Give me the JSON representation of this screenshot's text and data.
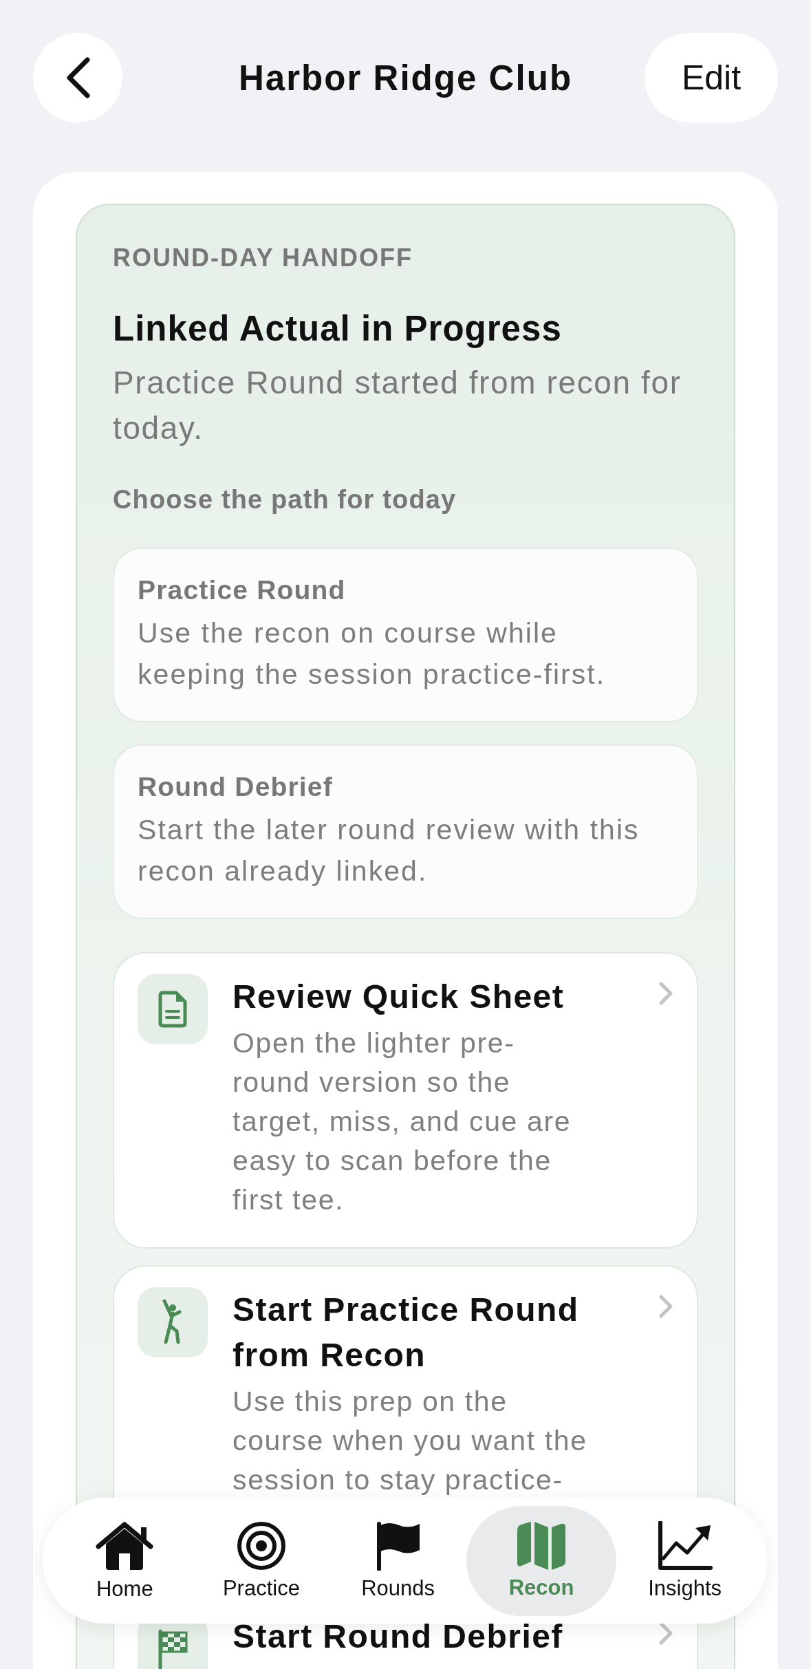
{
  "header": {
    "title": "Harbor Ridge Club",
    "edit": "Edit"
  },
  "handoff": {
    "eyebrow": "ROUND-DAY HANDOFF",
    "title": "Linked Actual in Progress",
    "subtitle": "Practice Round started from recon for today.",
    "prompt": "Choose the path for today",
    "options": [
      {
        "title": "Practice Round",
        "description": "Use the recon on course while keeping the session practice-first."
      },
      {
        "title": "Round Debrief",
        "description": "Start the later round review with this recon already linked."
      }
    ]
  },
  "actions": [
    {
      "title": "Review Quick Sheet",
      "description": "Open the lighter pre-round version so the target, miss, and cue are easy to scan before the first tee."
    },
    {
      "title": "Start Practice Round from Recon",
      "description": "Use this prep on the course when you want the session to stay practice-"
    },
    {
      "title": "Start Round Debrief"
    }
  ],
  "tabs": [
    {
      "label": "Home",
      "selected": false
    },
    {
      "label": "Practice",
      "selected": false
    },
    {
      "label": "Rounds",
      "selected": false
    },
    {
      "label": "Recon",
      "selected": true
    },
    {
      "label": "Insights",
      "selected": false
    }
  ]
}
